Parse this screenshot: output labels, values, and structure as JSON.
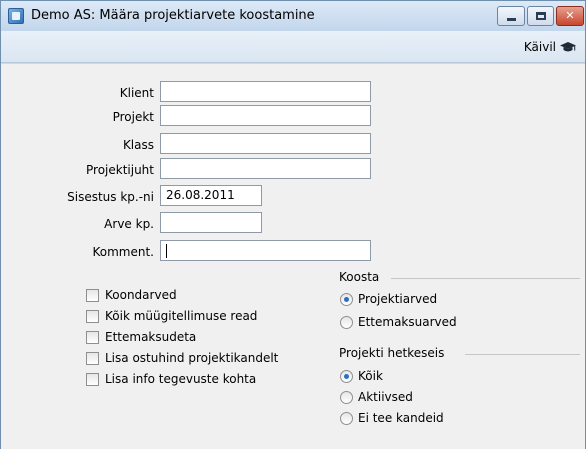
{
  "window": {
    "title": "Demo AS: Määra projektiarvete koostamine",
    "icon": "app-icon",
    "controls": [
      "minimize-icon",
      "maximize-icon",
      "close-icon"
    ]
  },
  "toolbar": {
    "run_label": "Käivil",
    "run_icon": "graduation-cap-icon"
  },
  "form": {
    "fields": [
      {
        "label": "Klient",
        "value": ""
      },
      {
        "label": "Projekt",
        "value": ""
      },
      {
        "label": "Klass",
        "value": ""
      },
      {
        "label": "Projektijuht",
        "value": ""
      },
      {
        "label": "Sisestus kp.-ni",
        "value": "26.08.2011"
      },
      {
        "label": "Arve kp.",
        "value": ""
      },
      {
        "label": "Komment.",
        "value": ""
      }
    ]
  },
  "options": {
    "checkboxes": [
      {
        "label": "Koondarved",
        "checked": false
      },
      {
        "label": "Kõik müügitellimuse read",
        "checked": false
      },
      {
        "label": "Ettemaksudeta",
        "checked": false
      },
      {
        "label": "Lisa ostuhind projektikandelt",
        "checked": false
      },
      {
        "label": "Lisa info tegevuste kohta",
        "checked": false
      }
    ]
  },
  "koosta": {
    "title": "Koosta",
    "options": [
      {
        "label": "Projektiarved",
        "selected": true
      },
      {
        "label": "Ettemaksuarved",
        "selected": false
      }
    ]
  },
  "seis": {
    "title": "Projekti hetkeseis",
    "options": [
      {
        "label": "Kõik",
        "selected": true
      },
      {
        "label": "Aktiivsed",
        "selected": false
      },
      {
        "label": "Ei tee kandeid",
        "selected": false
      }
    ]
  }
}
